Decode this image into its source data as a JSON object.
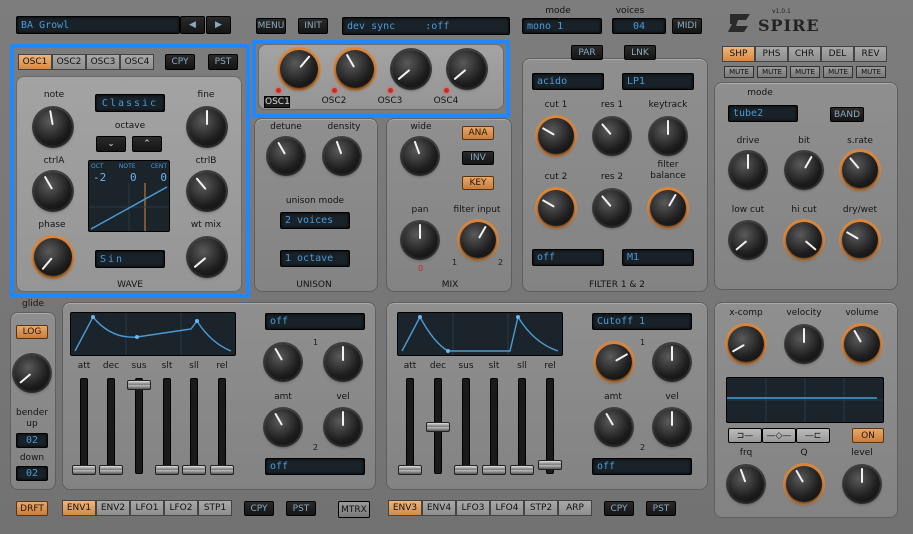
{
  "header": {
    "preset_name": "BA Growl",
    "menu_label": "MENU",
    "init_label": "INIT",
    "sync_display": "dev sync     :off",
    "mode_title": "mode",
    "mode_value": "mono 1",
    "voices_title": "voices",
    "voices_value": "04",
    "midi_label": "MIDI",
    "brand": "SPIRE",
    "version": "v1.0.1"
  },
  "osc": {
    "tabs": [
      "OSC1",
      "OSC2",
      "OSC3",
      "OSC4"
    ],
    "active_tab": "OSC1",
    "copy_label": "CPY",
    "paste_label": "PST",
    "note_label": "note",
    "fine_label": "fine",
    "mode_display": "Classic",
    "octave_label": "octave",
    "octave_down": "⌄",
    "octave_up": "⌃",
    "ctrlA_label": "ctrlA",
    "ctrlB_label": "ctrlB",
    "phase_label": "phase",
    "wtmix_label": "wt mix",
    "display_cols": [
      "OCT",
      "NOTE",
      "CENT"
    ],
    "display_vals": [
      "-2",
      "0",
      "0"
    ],
    "wave_display": "Sin",
    "wave_label": "WAVE"
  },
  "osc_levels": {
    "labels": [
      "OSC1",
      "OSC2",
      "OSC3",
      "OSC4"
    ]
  },
  "unison": {
    "detune_label": "detune",
    "density_label": "density",
    "mode_label": "unison mode",
    "voices_display": "2 voices",
    "octave_display": "1 octave",
    "section_label": "UNISON"
  },
  "mix": {
    "wide_label": "wide",
    "ana_label": "ANA",
    "inv_label": "INV",
    "key_label": "KEY",
    "pan_label": "pan",
    "filter_input_label": "filter input",
    "fi_min": "1",
    "fi_max": "2",
    "section_label": "MIX"
  },
  "filter": {
    "par_label": "PAR",
    "lnk_label": "LNK",
    "filter1_type": "acido",
    "filter2_type": "LP1",
    "cut1_label": "cut 1",
    "res1_label": "res 1",
    "keytrack_label": "keytrack",
    "cut2_label": "cut 2",
    "res2_label": "res 2",
    "balance_label": "filter\nbalance",
    "routing1": "off",
    "routing2": "M1",
    "section_label": "FILTER 1 & 2"
  },
  "fx": {
    "tabs": [
      "SHP",
      "PHS",
      "CHR",
      "DEL",
      "REV"
    ],
    "active_tab": "SHP",
    "mute_label": "MUTE",
    "mode_label": "mode",
    "mode_display": "tube2",
    "band_label": "BAND",
    "drive_label": "drive",
    "bit_label": "bit",
    "srate_label": "s.rate",
    "lowcut_label": "low cut",
    "hicut_label": "hi cut",
    "drywet_label": "dry/wet"
  },
  "glide": {
    "glide_label": "glide",
    "log_label": "LOG",
    "bender_up_label": "bender\nup",
    "bender_up_value": "02",
    "down_label": "down",
    "down_value": "02"
  },
  "env_left": {
    "fader_labels": [
      "att",
      "dec",
      "sus",
      "slt",
      "sll",
      "rel"
    ],
    "dest_top": "off",
    "dest_bottom": "off",
    "knob1_label": "1",
    "amt_label": "amt",
    "vel_label": "vel",
    "knob2_label": "2"
  },
  "env_right": {
    "fader_labels": [
      "att",
      "dec",
      "sus",
      "slt",
      "sll",
      "rel"
    ],
    "dest_top": "Cutoff 1",
    "dest_bottom": "off",
    "knob1_label": "1",
    "amt_label": "amt",
    "vel_label": "vel",
    "knob2_label": "2"
  },
  "bottom_left": {
    "drft_label": "DRFT",
    "tabs": [
      "ENV1",
      "ENV2",
      "LFO1",
      "LFO2",
      "STP1"
    ],
    "active_tab": "ENV1",
    "copy_label": "CPY",
    "paste_label": "PST",
    "mtrx_label": "MTRX"
  },
  "bottom_right": {
    "tabs": [
      "ENV3",
      "ENV4",
      "LFO3",
      "LFO4",
      "STP2",
      "ARP"
    ],
    "active_tab": "ENV3",
    "copy_label": "CPY",
    "paste_label": "PST"
  },
  "output": {
    "xcomp_label": "x-comp",
    "velocity_label": "velocity",
    "volume_label": "volume",
    "on_label": "ON",
    "frq_label": "frq",
    "q_label": "Q",
    "level_label": "level"
  },
  "colors": {
    "accent": "#d9883f",
    "highlight": "#1e88ff",
    "lcd_text": "#4a9bd6"
  }
}
